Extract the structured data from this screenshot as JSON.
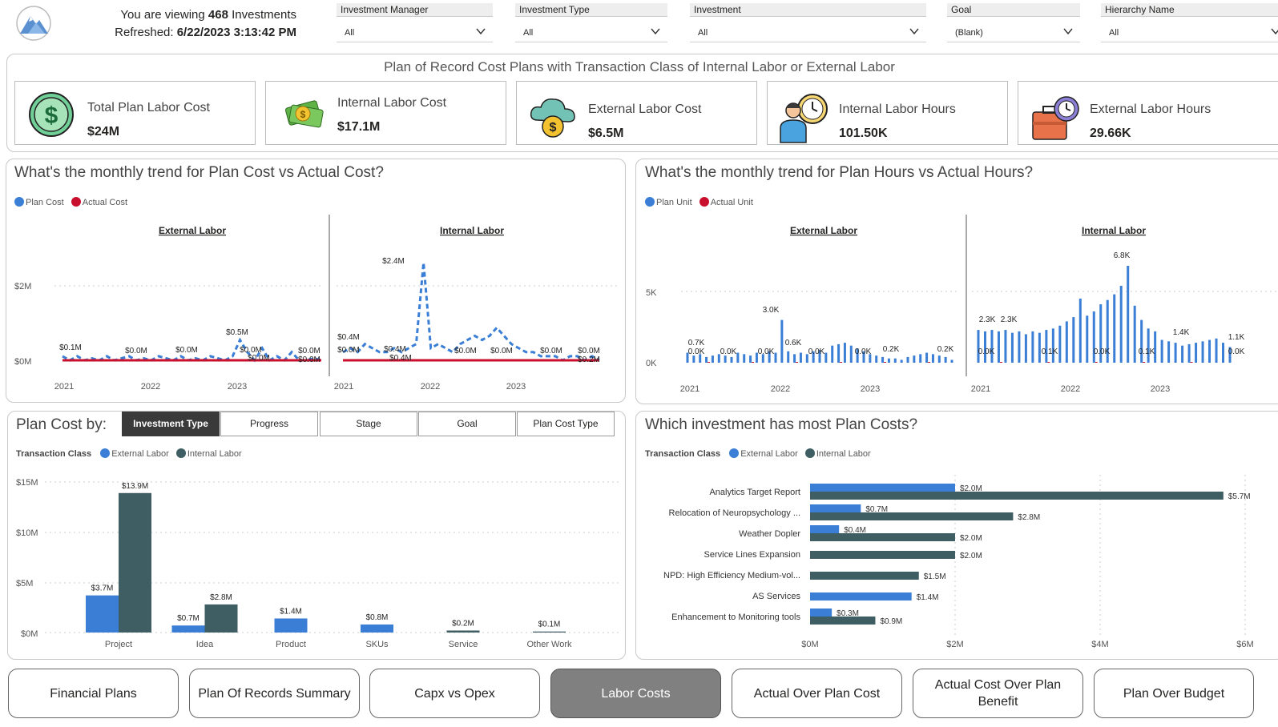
{
  "header": {
    "viewing_prefix": "You are viewing",
    "viewing_count": "468",
    "viewing_suffix": "Investments",
    "refreshed_label": "Refreshed:",
    "refreshed_value": "6/22/2023 3:13:42 PM"
  },
  "slicers": [
    {
      "title": "Investment Manager",
      "value": "All"
    },
    {
      "title": "Investment Type",
      "value": "All"
    },
    {
      "title": "Investment",
      "value": "All"
    },
    {
      "title": "Goal",
      "value": "(Blank)"
    },
    {
      "title": "Hierarchy Name",
      "value": "All"
    }
  ],
  "kpi": {
    "heading": "Plan of Record Cost Plans with Transaction Class of Internal Labor or External Labor",
    "cards": [
      {
        "label": "Total Plan Labor Cost",
        "value": "$24M",
        "icon": "dollar-coin-icon"
      },
      {
        "label": "Internal Labor Cost",
        "value": "$17.1M",
        "icon": "cash-stack-icon"
      },
      {
        "label": "External Labor Cost",
        "value": "$6.5M",
        "icon": "cloud-dollar-icon"
      },
      {
        "label": "Internal Labor Hours",
        "value": "101.50K",
        "icon": "worker-clock-icon"
      },
      {
        "label": "External Labor Hours",
        "value": "29.66K",
        "icon": "briefcase-clock-icon"
      }
    ]
  },
  "colors": {
    "plan": "#3a7fd5",
    "actual": "#c8102e",
    "external": "#3a7fd5",
    "internal": "#3f5e63",
    "active_nav": "#808080"
  },
  "cost_trend": {
    "title": "What's the monthly trend for Plan Cost vs Actual Cost?",
    "legend": [
      "Plan Cost",
      "Actual Cost"
    ],
    "facets": [
      "External Labor",
      "Internal Labor"
    ],
    "y_ticks": [
      "$2M",
      "$0M"
    ],
    "x_ticks": [
      "2021",
      "2022",
      "2023"
    ],
    "ext_labels": [
      "$0.1M",
      "$0.0M",
      "$0.0M",
      "$0.5M",
      "$0.0M",
      "$0.0M",
      "$0.0M",
      "$0.0M"
    ],
    "int_labels": [
      "$2.4M",
      "$0.4M",
      "$0.0M",
      "$0.4M",
      "$0.4M",
      "$0.0M",
      "$0.0M",
      "$0.0M",
      "$0.0M",
      "$0.2M"
    ]
  },
  "hours_trend": {
    "title": "What's the monthly trend for Plan Hours vs Actual Hours?",
    "legend": [
      "Plan Unit",
      "Actual Unit"
    ],
    "facets": [
      "External Labor",
      "Internal Labor"
    ],
    "y_ticks": [
      "5K",
      "0K"
    ],
    "x_ticks": [
      "2021",
      "2022",
      "2023"
    ],
    "ext_labels": [
      "0.7K",
      "0.0K",
      "0.0K",
      "3.0K",
      "0.0K",
      "0.6K",
      "0.0K",
      "0.0K",
      "0.2K",
      "0.2K"
    ],
    "int_labels": [
      "2.3K",
      "2.3K",
      "0.0K",
      "0.1K",
      "6.8K",
      "0.0K",
      "0.1K",
      "1.4K",
      "0.0K",
      "1.1K"
    ]
  },
  "plan_cost_by": {
    "title": "Plan Cost by:",
    "tabs": [
      "Investment Type",
      "Progress",
      "Stage",
      "Goal",
      "Plan Cost Type"
    ],
    "active_tab": "Investment Type",
    "legend_title": "Transaction Class",
    "legend": [
      "External Labor",
      "Internal Labor"
    ],
    "y_ticks": [
      "$15M",
      "$10M",
      "$5M",
      "$0M"
    ]
  },
  "most_costs": {
    "title": "Which investment has most Plan Costs?",
    "legend_title": "Transaction Class",
    "legend": [
      "External Labor",
      "Internal Labor"
    ],
    "x_ticks": [
      "$0M",
      "$2M",
      "$4M",
      "$6M"
    ]
  },
  "chart_data": [
    {
      "type": "bar",
      "title": "Plan Cost by:",
      "categories": [
        "Project",
        "Idea",
        "Product",
        "SKUs",
        "Service",
        "Other Work"
      ],
      "series": [
        {
          "name": "External Labor",
          "values": [
            3.7,
            0.7,
            1.4,
            0.8,
            null,
            null
          ],
          "labels": [
            "$3.7M",
            "$0.7M",
            "$1.4M",
            "$0.8M",
            "",
            ""
          ]
        },
        {
          "name": "Internal Labor",
          "values": [
            13.9,
            2.8,
            null,
            null,
            0.2,
            0.1
          ],
          "labels": [
            "$13.9M",
            "$2.8M",
            "",
            "",
            "$0.2M",
            "$0.1M"
          ]
        }
      ],
      "ylabel": "",
      "ylim": [
        0,
        15
      ]
    },
    {
      "type": "bar",
      "orientation": "horizontal",
      "title": "Which investment has most Plan Costs?",
      "categories": [
        "Analytics Target Report",
        "Relocation of Neuropsychology ...",
        "Weather Dopler",
        "Service Lines Expansion",
        "NPD: High Efficiency Medium-vol...",
        "AS Services",
        "Enhancement to Monitoring tools"
      ],
      "series": [
        {
          "name": "External Labor",
          "values": [
            2.0,
            0.7,
            0.4,
            null,
            null,
            1.4,
            0.3
          ],
          "labels": [
            "$2.0M",
            "$0.7M",
            "$0.4M",
            "",
            "",
            "$1.4M",
            "$0.3M"
          ]
        },
        {
          "name": "Internal Labor",
          "values": [
            5.7,
            2.8,
            2.0,
            2.0,
            1.5,
            null,
            0.9
          ],
          "labels": [
            "$5.7M",
            "$2.8M",
            "$2.0M",
            "$2.0M",
            "$1.5M",
            "",
            "$0.9M"
          ]
        }
      ],
      "xlim": [
        0,
        6
      ]
    },
    {
      "type": "line",
      "title": "What's the monthly trend for Plan Cost vs Actual Cost?",
      "facet": "External Labor",
      "x": [
        "2021",
        "2022",
        "2023"
      ],
      "series": [
        {
          "name": "Plan Cost",
          "values": [
            0.1,
            0.0,
            0.1,
            0.0,
            0.05,
            0.0,
            0.1,
            0.0,
            0.05,
            0.1,
            0.0,
            0.05,
            0.0,
            0.1,
            0.05,
            0.0,
            0.1,
            0.0,
            0.05,
            0.0,
            0.1,
            0.05,
            0.0,
            0.1,
            0.5,
            0.2,
            0.0,
            0.3,
            0.0,
            0.1,
            0.0,
            0.2,
            0.0,
            0.0,
            0.05,
            0.0
          ]
        },
        {
          "name": "Actual Cost",
          "values": [
            0,
            0,
            0,
            0,
            0,
            0,
            0,
            0,
            0,
            0,
            0,
            0,
            0,
            0,
            0,
            0,
            0,
            0,
            0,
            0,
            0,
            0,
            0,
            0,
            0,
            0,
            0,
            0,
            0,
            0,
            0,
            0,
            0,
            0,
            0,
            0
          ]
        }
      ],
      "ylim": [
        0,
        2.5
      ]
    },
    {
      "type": "line",
      "title": "What's the monthly trend for Plan Cost vs Actual Cost?",
      "facet": "Internal Labor",
      "x": [
        "2021",
        "2022",
        "2023"
      ],
      "series": [
        {
          "name": "Plan Cost",
          "values": [
            0.2,
            0.3,
            0.2,
            0.4,
            0.3,
            0.2,
            0.2,
            0.3,
            0.2,
            0.3,
            0.4,
            2.4,
            0.3,
            0.4,
            0.3,
            0.2,
            0.4,
            0.5,
            0.6,
            0.5,
            0.6,
            0.8,
            0.6,
            0.4,
            0.3,
            0.2,
            0.2,
            0.1,
            0.1,
            0.1,
            0.0,
            0.1,
            0.1,
            0.0,
            0.1,
            0.0
          ]
        },
        {
          "name": "Actual Cost",
          "values": [
            0,
            0,
            0,
            0,
            0,
            0,
            0,
            0,
            0,
            0,
            0,
            0,
            0,
            0,
            0,
            0,
            0,
            0,
            0,
            0,
            0,
            0,
            0,
            0,
            0,
            0,
            0,
            0,
            0,
            0,
            0,
            0,
            0,
            0,
            0,
            0
          ]
        }
      ],
      "ylim": [
        0,
        2.5
      ]
    },
    {
      "type": "bar",
      "title": "What's the monthly trend for Plan Hours vs Actual Hours?",
      "facet": "External Labor",
      "x": [
        "2021",
        "2022",
        "2023"
      ],
      "series": [
        {
          "name": "Plan Unit",
          "values": [
            0.7,
            0.5,
            0.6,
            0.4,
            0.5,
            0.6,
            0.5,
            0.4,
            0.7,
            0.6,
            0.5,
            0.7,
            0.6,
            0.8,
            0.7,
            3.0,
            0.8,
            0.6,
            0.7,
            0.6,
            0.8,
            0.9,
            0.7,
            1.2,
            1.3,
            1.4,
            1.2,
            1.0,
            0.8,
            0.6,
            0.5,
            0.4,
            0.3,
            0.3,
            0.2,
            0.4,
            0.5,
            0.6,
            0.7,
            0.6,
            0.5,
            0.4,
            0.2
          ]
        },
        {
          "name": "Actual Unit",
          "values": [
            0,
            0,
            0,
            0,
            0,
            0,
            0,
            0,
            0,
            0,
            0,
            0,
            0,
            0,
            0,
            0,
            0,
            0,
            0,
            0,
            0,
            0,
            0,
            0,
            0,
            0,
            0,
            0,
            0,
            0,
            0,
            0,
            0,
            0,
            0,
            0,
            0,
            0,
            0,
            0,
            0,
            0,
            0
          ]
        }
      ],
      "ylim": [
        0,
        7
      ]
    },
    {
      "type": "bar",
      "title": "What's the monthly trend for Plan Hours vs Actual Hours?",
      "facet": "Internal Labor",
      "x": [
        "2021",
        "2022",
        "2023"
      ],
      "series": [
        {
          "name": "Plan Unit",
          "values": [
            2.3,
            2.2,
            2.3,
            2.2,
            2.3,
            2.1,
            2.2,
            2.0,
            2.2,
            2.1,
            2.3,
            2.4,
            2.6,
            2.9,
            3.2,
            4.5,
            3.3,
            3.6,
            4.1,
            4.4,
            4.8,
            5.4,
            6.8,
            4.0,
            3.0,
            2.4,
            2.2,
            1.6,
            1.5,
            1.4,
            1.2,
            1.3,
            1.4,
            1.5,
            1.6,
            1.7,
            1.4,
            1.1
          ]
        },
        {
          "name": "Actual Unit",
          "values": [
            0,
            0,
            0,
            0,
            0,
            0,
            0,
            0,
            0,
            0,
            0,
            0,
            0,
            0,
            0,
            0,
            0,
            0,
            0,
            0,
            0,
            0,
            0,
            0,
            0,
            0,
            0,
            0,
            0,
            0,
            0,
            0,
            0,
            0,
            0,
            0,
            0,
            0
          ]
        }
      ],
      "ylim": [
        0,
        7
      ]
    }
  ],
  "nav": {
    "buttons": [
      "Financial Plans",
      "Plan Of Records Summary",
      "Capx vs Opex",
      "Labor Costs",
      "Actual Over Plan Cost",
      "Actual Cost Over Plan Benefit",
      "Plan Over Budget"
    ],
    "active": "Labor Costs"
  }
}
